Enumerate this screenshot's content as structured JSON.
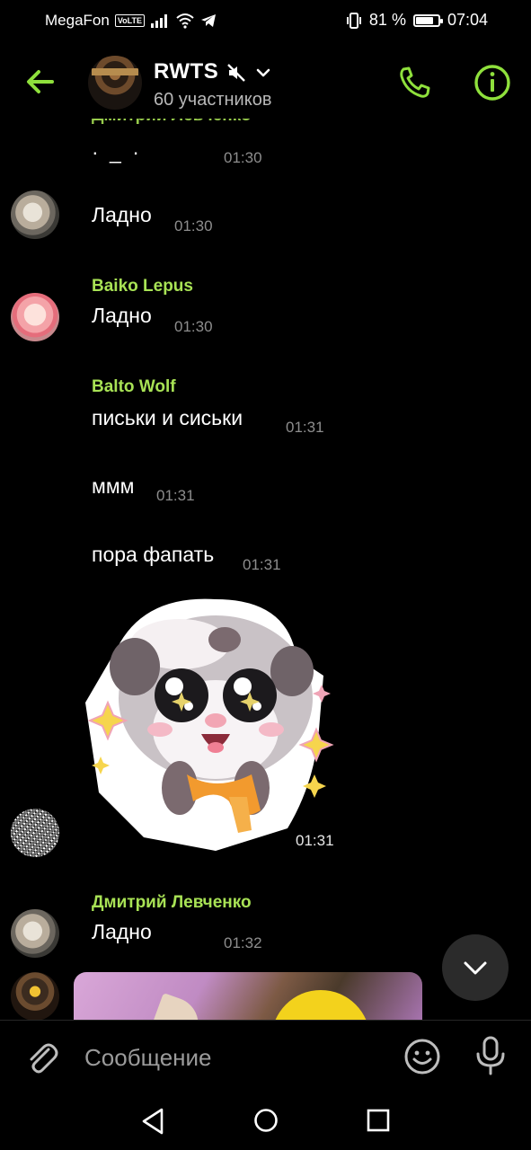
{
  "status_bar": {
    "carrier": "MegaFon",
    "volte": "VoLTE",
    "battery_percent": "81 %",
    "battery_level": 0.81,
    "time": "07:04"
  },
  "header": {
    "title": "RWTS",
    "subtitle": "60 участников",
    "icons": [
      "back-arrow-icon",
      "mute-icon",
      "chevron-down-icon",
      "phone-icon",
      "info-icon"
    ],
    "accent_color": "#8fe03c"
  },
  "messages": {
    "m0": {
      "sender": "Дмитрий Левченко",
      "text": "· _ ·",
      "time": "01:30"
    },
    "m1": {
      "text": "Ладно",
      "time": "01:30"
    },
    "m2": {
      "sender": "Baiko Lepus",
      "text": "Ладно",
      "time": "01:30"
    },
    "m3": {
      "sender": "Balto Wolf",
      "text": "письки и сиськи",
      "time": "01:31"
    },
    "m4": {
      "text": "ммм",
      "time": "01:31"
    },
    "m5": {
      "text": "пора фапать",
      "time": "01:31"
    },
    "m6": {
      "sticker": "ferret-sticker",
      "time": "01:31"
    },
    "m7": {
      "sender": "Дмитрий Левченко",
      "text": "Ладно",
      "time": "01:32"
    }
  },
  "input": {
    "placeholder": "Сообщение",
    "value": ""
  },
  "colors": {
    "background": "#000000",
    "sender_name": "#a8e255",
    "time": "#8d8d8d"
  }
}
